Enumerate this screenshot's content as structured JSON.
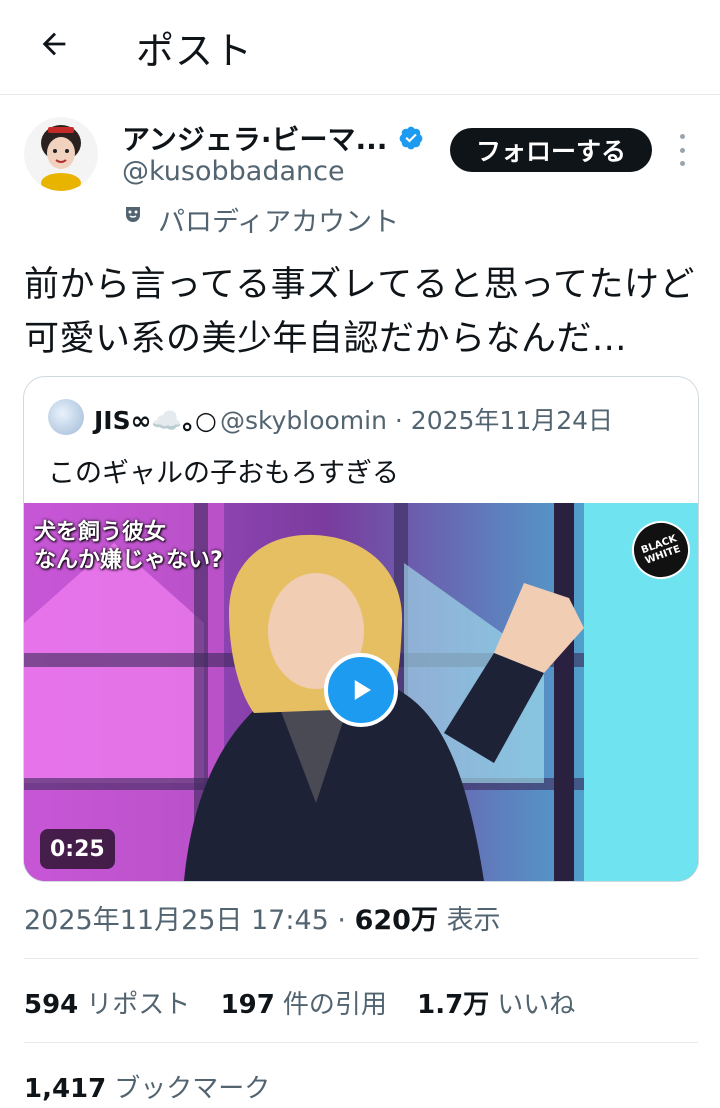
{
  "header": {
    "title": "ポスト",
    "back_icon": "arrow-left-icon"
  },
  "author": {
    "name": "アンジェラ·ビーマ...",
    "handle": "@kusobbadance",
    "parody_label": "パロディアカウント",
    "follow_label": "フォローする",
    "verified_color": "#1d9bf0"
  },
  "tweet": {
    "text": "前から言ってる事ズレてると思ってたけど可愛い系の美少年自認だからなんだ..."
  },
  "quote": {
    "name": "JIS∞☁️｡○",
    "meta": "@skybloomin · 2025年11月24日",
    "text": "このギャルの子おもろすぎる",
    "video": {
      "caption_line1": "犬を飼う彼女",
      "caption_line2": "なんか嫌じゃない?",
      "logo_text_1": "BLACK",
      "logo_text_2": "WHITE",
      "duration": "0:25",
      "play_color": "#1d9bf0"
    }
  },
  "meta": {
    "datetime": "2025年11月25日 17:45 · ",
    "views": "620万",
    "views_label": " 表示"
  },
  "stats": {
    "reposts": "594",
    "reposts_label": "リポスト",
    "quotes": "197",
    "quotes_label": "件の引用",
    "likes": "1.7万",
    "likes_label": "いいね",
    "bookmarks": "1,417",
    "bookmarks_label": "ブックマーク"
  }
}
